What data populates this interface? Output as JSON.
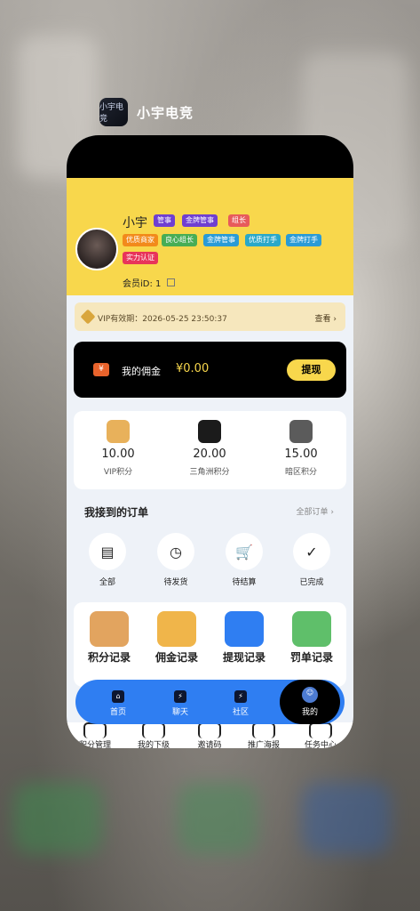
{
  "app": {
    "name": "小宇电竞",
    "icon_text": "小宇电竞"
  },
  "profile": {
    "username": "小宇",
    "tags_row1": [
      "管事",
      "金牌管事",
      "组长"
    ],
    "tags_row2": [
      "优质商家",
      "良心组长",
      "金牌管事",
      "优质打手",
      "金牌打手"
    ],
    "tags_row3": [
      "实力认证"
    ],
    "member_id": "会员iD: 1"
  },
  "vip": {
    "text": "VIP有效期：2026-05-25 23:50:37",
    "more": "查看 ›"
  },
  "wallet": {
    "label": "我的佣金",
    "amount": "¥0.00",
    "button": "提现",
    "icon_text": "¥"
  },
  "points": [
    {
      "value": "10.00",
      "label": "VIP积分",
      "icon": "vip-badge-icon"
    },
    {
      "value": "20.00",
      "label": "三角洲积分",
      "icon": "delta-icon"
    },
    {
      "value": "15.00",
      "label": "暗区积分",
      "icon": "dark-zone-icon"
    }
  ],
  "orders": {
    "title": "我接到的订单",
    "all": "全部订单 ›",
    "items": [
      {
        "label": "全部",
        "icon": "▤"
      },
      {
        "label": "待发货",
        "icon": "◷"
      },
      {
        "label": "待结算",
        "icon": "🛒"
      },
      {
        "label": "已完成",
        "icon": "✓"
      }
    ]
  },
  "records": [
    "积分记录",
    "佣金记录",
    "提现记录",
    "罚单记录"
  ],
  "tabbar": [
    {
      "label": "首页",
      "icon": "⌂"
    },
    {
      "label": "聊天",
      "icon": "⚡"
    },
    {
      "label": "社区",
      "icon": "⚡"
    },
    {
      "label": "我的",
      "icon": "☺"
    }
  ],
  "bottom_strip": [
    "积分管理",
    "我的下级",
    "邀请码",
    "推广海报",
    "任务中心"
  ],
  "colors": {
    "yellow": "#f8d74c",
    "blue": "#2f7ef2",
    "black": "#000000"
  }
}
